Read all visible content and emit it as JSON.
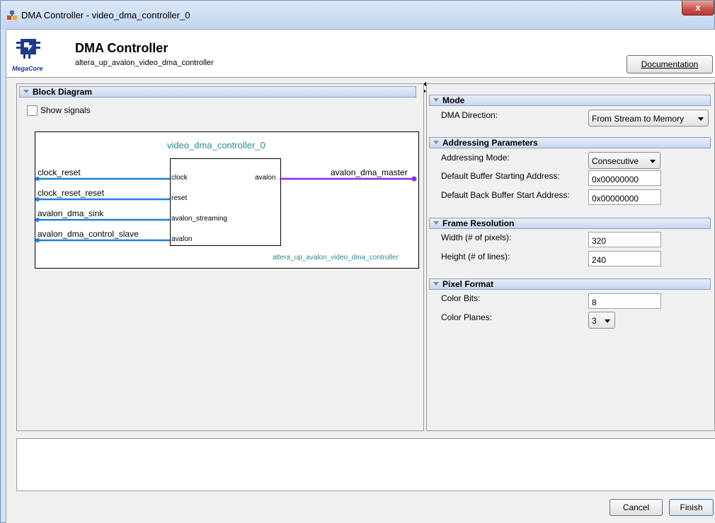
{
  "window": {
    "title": "DMA Controller - video_dma_controller_0",
    "close_label": "x"
  },
  "header": {
    "title": "DMA Controller",
    "subtitle": "altera_up_avalon_video_dma_controller",
    "logo_text": "MegaCore",
    "documentation_button": "Documentation"
  },
  "block_diagram": {
    "section_title": "Block Diagram",
    "show_signals_label": "Show signals",
    "show_signals_checked": false,
    "instance_name": "video_dma_controller_0",
    "component_name": "altera_up_avalon_video_dma_controller",
    "left_interfaces": [
      "clock_reset",
      "clock_reset_reset",
      "avalon_dma_sink",
      "avalon_dma_control_slave"
    ],
    "inner_ports_left": [
      "clock",
      "reset",
      "avalon_streaming",
      "avalon"
    ],
    "inner_port_right": "avalon",
    "right_interface": "avalon_dma_master",
    "colors": {
      "left_wires": "#1e7fe0",
      "right_wire": "#8b2be2",
      "title": "#2a8a8a"
    }
  },
  "mode": {
    "section_title": "Mode",
    "dma_direction_label": "DMA Direction:",
    "dma_direction_value": "From Stream to Memory"
  },
  "addressing": {
    "section_title": "Addressing Parameters",
    "mode_label": "Addressing Mode:",
    "mode_value": "Consecutive",
    "buffer_start_label": "Default Buffer Starting Address:",
    "buffer_start_value": "0x00000000",
    "back_buffer_label": "Default Back Buffer Start Address:",
    "back_buffer_value": "0x00000000"
  },
  "frame_resolution": {
    "section_title": "Frame Resolution",
    "width_label": "Width (# of pixels):",
    "width_value": "320",
    "height_label": "Height (# of lines):",
    "height_value": "240"
  },
  "pixel_format": {
    "section_title": "Pixel Format",
    "color_bits_label": "Color Bits:",
    "color_bits_value": "8",
    "color_planes_label": "Color Planes:",
    "color_planes_value": "3"
  },
  "footer": {
    "cancel_label": "Cancel",
    "finish_label": "Finish"
  }
}
